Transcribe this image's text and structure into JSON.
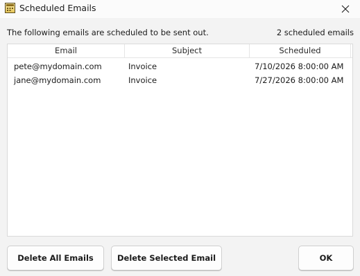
{
  "window": {
    "title": "Scheduled Emails",
    "app_icon": "calendar-app-icon",
    "close_icon": "close-icon"
  },
  "header": {
    "description": "The following emails are scheduled to be sent out.",
    "count": "2 scheduled emails"
  },
  "table": {
    "columns": [
      "Email",
      "Subject",
      "Scheduled"
    ],
    "rows": [
      {
        "email": "pete@mydomain.com",
        "subject": "Invoice",
        "scheduled": "7/10/2026 8:00:00 AM"
      },
      {
        "email": "jane@mydomain.com",
        "subject": "Invoice",
        "scheduled": "7/27/2026 8:00:00 AM"
      }
    ]
  },
  "buttons": {
    "delete_all": "Delete All Emails",
    "delete_selected": "Delete Selected Email",
    "ok": "OK"
  }
}
